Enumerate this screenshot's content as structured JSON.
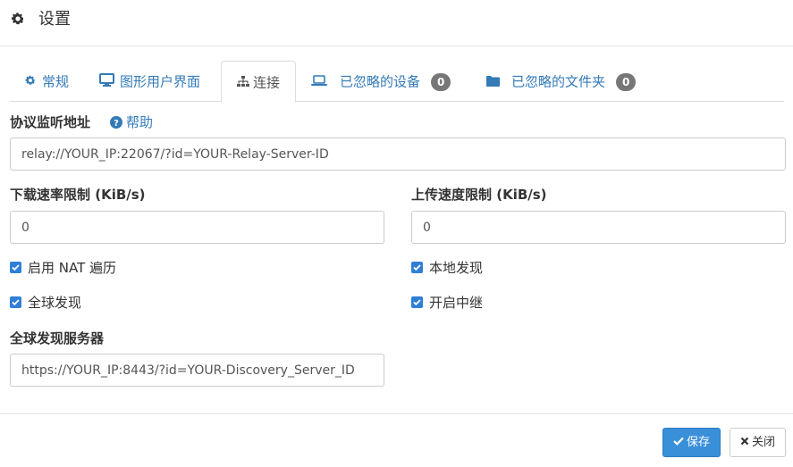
{
  "header": {
    "title": "设置",
    "icon": "gear-icon"
  },
  "tabs": [
    {
      "label": "常规",
      "icon": "gear-icon",
      "active": false
    },
    {
      "label": "图形用户界面",
      "icon": "desktop-icon",
      "active": false
    },
    {
      "label": "连接",
      "icon": "sitemap-icon",
      "active": true
    },
    {
      "label": "已忽略的设备",
      "icon": "laptop-icon",
      "badge": "0",
      "active": false
    },
    {
      "label": "已忽略的文件夹",
      "icon": "folder-icon",
      "badge": "0",
      "active": false
    }
  ],
  "protocol": {
    "label": "协议监听地址",
    "help": "帮助",
    "value": "relay://YOUR_IP:22067/?id=YOUR-Relay-Server-ID"
  },
  "download": {
    "label": "下载速率限制 (KiB/s)",
    "value": "0"
  },
  "upload": {
    "label": "上传速度限制 (KiB/s)",
    "value": "0"
  },
  "checkboxes": [
    {
      "label": "启用 NAT 遍历",
      "checked": true
    },
    {
      "label": "本地发现",
      "checked": true
    },
    {
      "label": "全球发现",
      "checked": true
    },
    {
      "label": "开启中继",
      "checked": true
    }
  ],
  "discovery": {
    "label": "全球发现服务器",
    "value": "https://YOUR_IP:8443/?id=YOUR-Discovery_Server_ID"
  },
  "footer": {
    "save_label": "保存",
    "close_label": "关闭"
  },
  "colors": {
    "accent": "#337ab7",
    "save_button": "#3a8fd9",
    "badge": "#777777",
    "checkbox": "#2f7fd6"
  }
}
